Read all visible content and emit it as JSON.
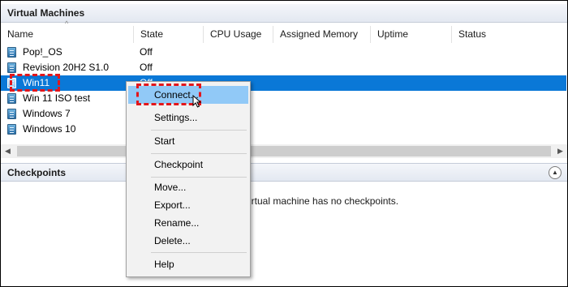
{
  "vm_section": {
    "title": "Virtual Machines"
  },
  "columns": [
    "Name",
    "State",
    "CPU Usage",
    "Assigned Memory",
    "Uptime",
    "Status"
  ],
  "sort_arrow": "^",
  "vms": [
    {
      "name": "Pop!_OS",
      "state": "Off"
    },
    {
      "name": "Revision 20H2 S1.0",
      "state": "Off"
    },
    {
      "name": "Win11",
      "state": "Off",
      "selected": true
    },
    {
      "name": "Win 11 ISO test",
      "state": ""
    },
    {
      "name": "Windows 7",
      "state": ""
    },
    {
      "name": "Windows 10",
      "state": ""
    }
  ],
  "scroll": {
    "left_arrow": "◀",
    "right_arrow": "▶"
  },
  "checkpoints_section": {
    "title": "Checkpoints",
    "collapse_glyph": "▲",
    "empty_message": "irtual machine has no checkpoints."
  },
  "context_menu": {
    "items": [
      "Connect...",
      "Settings...",
      "Start",
      "Checkpoint",
      "Move...",
      "Export...",
      "Rename...",
      "Delete...",
      "Help"
    ],
    "highlighted": "Connect..."
  },
  "colors": {
    "selection": "#0a78d7",
    "menu_highlight": "#91c9f7",
    "annotation": "#e3161b"
  }
}
